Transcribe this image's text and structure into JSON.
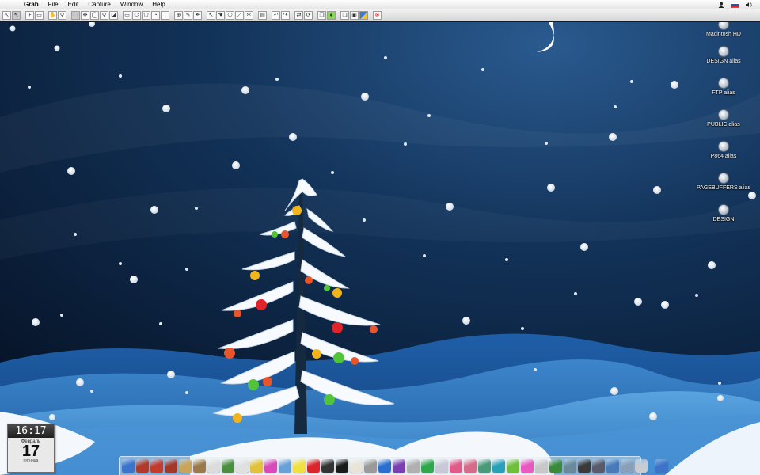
{
  "menubar": {
    "app_name": "Grab",
    "menus": [
      "File",
      "Edit",
      "Capture",
      "Window",
      "Help"
    ]
  },
  "desktop_icons": [
    {
      "label": "Macintosh HD",
      "name": "macintosh-hd"
    },
    {
      "label": "DESIGN alias",
      "name": "design-alias"
    },
    {
      "label": "FTP alias",
      "name": "ftp-alias"
    },
    {
      "label": "PUBLIC alias",
      "name": "public-alias"
    },
    {
      "label": "P864 alias",
      "name": "p864-alias"
    },
    {
      "label": "PAGEBUFFERS alias",
      "name": "pagebuffers-alias"
    },
    {
      "label": "DESIGN",
      "name": "design"
    }
  ],
  "clock": {
    "time": "16:17",
    "month": "Февраль",
    "day": "17",
    "weekday": "пятница"
  },
  "colors": {
    "sky_top": "#08172b",
    "sky_mid": "#1a4576",
    "hills_front": "#2b6cb0",
    "snow": "#f4f8fc"
  },
  "dock_icons": [
    "finder-icon",
    "app-icon",
    "app-icon",
    "app-icon",
    "book-icon",
    "folder-icon",
    "itunes-icon",
    "app-icon",
    "tree-icon",
    "app-icon",
    "app-icon",
    "app-icon",
    "app-icon",
    "app-icon",
    "terminal-icon",
    "monitor-icon",
    "app-icon",
    "calculator-icon",
    "word-icon",
    "app-icon",
    "app-icon",
    "app-icon",
    "app-icon",
    "app-icon",
    "app-icon",
    "app-icon",
    "app-icon",
    "app-icon",
    "app-icon",
    "app-icon",
    "app-icon",
    "app-icon",
    "app-icon",
    "app-icon",
    "app-icon",
    "app-icon",
    "app-icon",
    "trash-icon"
  ]
}
